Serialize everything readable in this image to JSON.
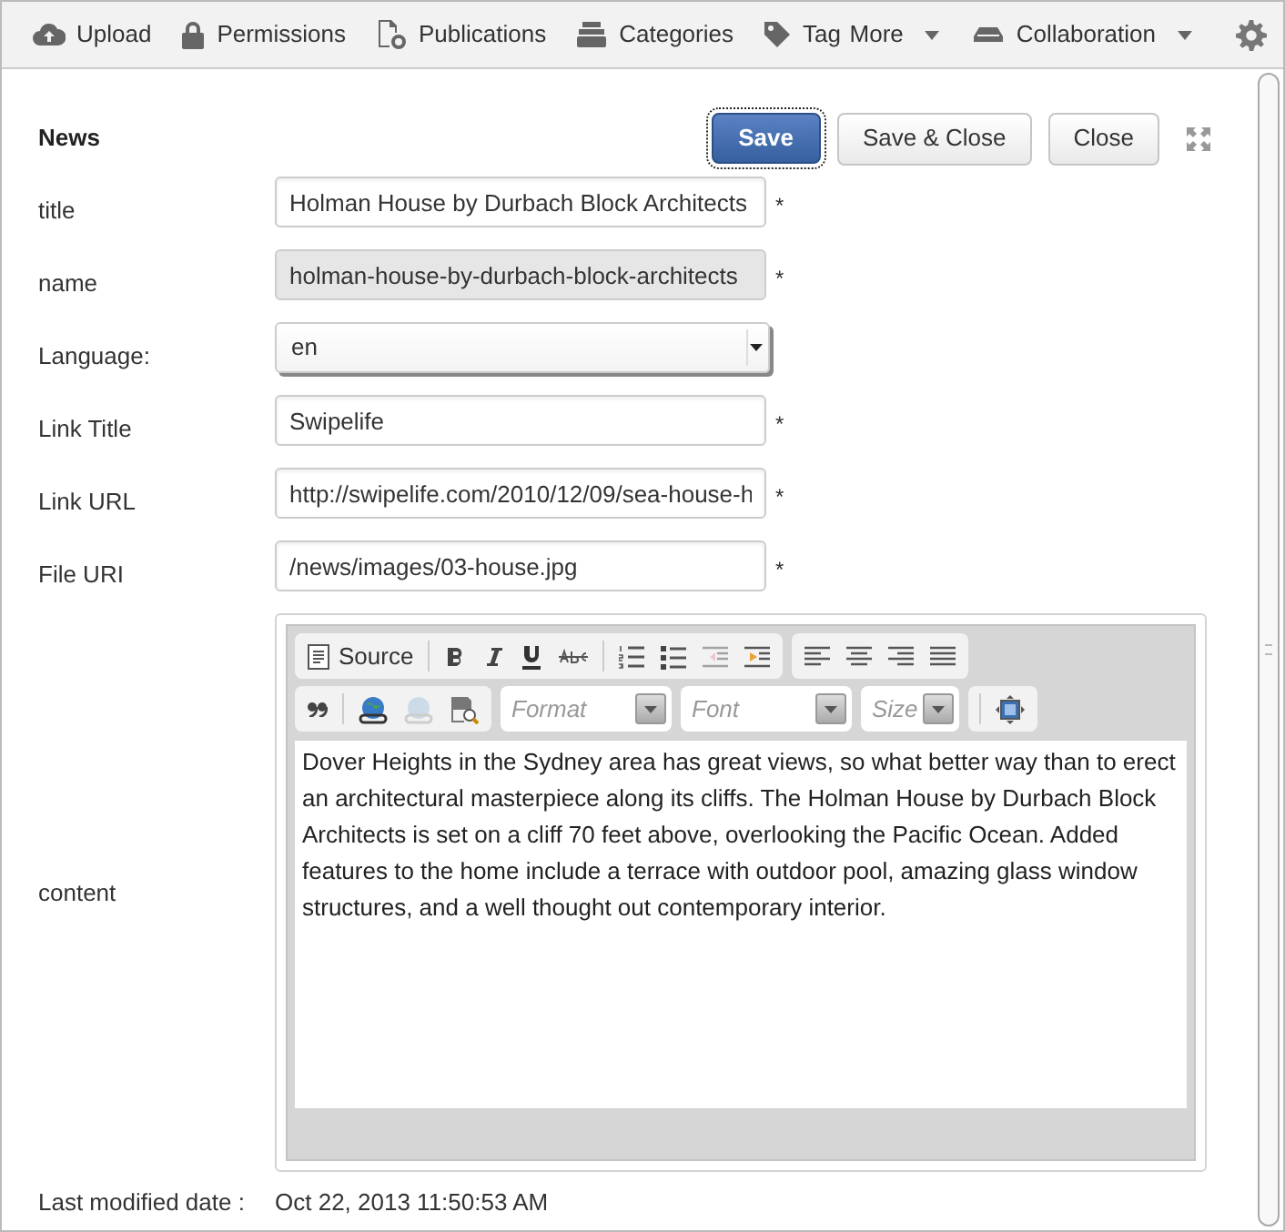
{
  "toolbar": {
    "left": [
      {
        "kind": "upload",
        "label": "Upload"
      },
      {
        "kind": "lock",
        "label": "Permissions"
      },
      {
        "kind": "publications",
        "label": "Publications"
      },
      {
        "kind": "categories",
        "label": "Categories"
      },
      {
        "kind": "tag",
        "label": "Tag"
      }
    ],
    "right": [
      {
        "kind": "more",
        "label": "More"
      },
      {
        "kind": "collab",
        "label": "Collaboration"
      }
    ]
  },
  "form": {
    "heading": "News",
    "buttons": [
      {
        "label": "Save",
        "kind": "primary"
      },
      {
        "label": "Save & Close",
        "kind": "default"
      },
      {
        "label": "Close",
        "kind": "default"
      }
    ],
    "fields": [
      {
        "label": "title",
        "kind": "input",
        "value": "Holman House by Durbach Block Architects",
        "required_mark": "*"
      },
      {
        "label": "name",
        "kind": "readonly",
        "value": "holman-house-by-durbach-block-architects",
        "required_mark": "*"
      },
      {
        "label": "Language:",
        "kind": "select",
        "value": "en"
      },
      {
        "label": "Link Title",
        "kind": "input",
        "value": "Swipelife",
        "required_mark": "*"
      },
      {
        "label": "Link URL",
        "kind": "input",
        "value": "http://swipelife.com/2010/12/09/sea-house-h",
        "required_mark": "*"
      },
      {
        "label": "File URI",
        "kind": "input",
        "value": "/news/images/03-house.jpg",
        "required_mark": "*"
      }
    ],
    "content": {
      "label": "content",
      "toolbar_rows": [
        [
          [
            {
              "kind": "source",
              "label": "Source",
              "disabled": false
            },
            {
              "kind": "sep"
            },
            {
              "kind": "bold",
              "disabled": false
            },
            {
              "kind": "italic",
              "disabled": false
            },
            {
              "kind": "underline",
              "disabled": false
            },
            {
              "kind": "strike",
              "disabled": false
            },
            {
              "kind": "sep"
            },
            {
              "kind": "ol",
              "disabled": false
            },
            {
              "kind": "ul",
              "disabled": false
            },
            {
              "kind": "outdent",
              "disabled": true
            },
            {
              "kind": "indent",
              "disabled": false
            }
          ],
          [
            {
              "kind": "left",
              "disabled": false
            },
            {
              "kind": "center",
              "disabled": false
            },
            {
              "kind": "right",
              "disabled": false
            },
            {
              "kind": "justify",
              "disabled": false
            }
          ]
        ],
        [
          [
            {
              "kind": "quote",
              "disabled": false
            },
            {
              "kind": "sep"
            },
            {
              "kind": "link",
              "disabled": false
            },
            {
              "kind": "unlink",
              "disabled": true
            },
            {
              "kind": "anchor",
              "disabled": false
            }
          ],
          [
            {
              "kind": "combo",
              "label": "Format"
            }
          ],
          [
            {
              "kind": "combo",
              "label": "Font"
            }
          ],
          [
            {
              "kind": "combo_small",
              "label": "Size"
            }
          ],
          [
            {
              "kind": "sep"
            },
            {
              "kind": "maximize",
              "disabled": false
            }
          ]
        ]
      ],
      "text": "Dover Heights in the Sydney area has great views, so what better way than to erect an architectural masterpiece along its cliffs. The Holman House by Durbach Block Architects is set on a cliff 70 feet above, overlooking the Pacific Ocean. Added features to the home include a terrace with outdoor pool, amazing glass window structures, and a well thought out contemporary interior."
    },
    "modified": {
      "label": "Last modified date :",
      "value": "Oct 22, 2013 11:50:53 AM"
    }
  }
}
